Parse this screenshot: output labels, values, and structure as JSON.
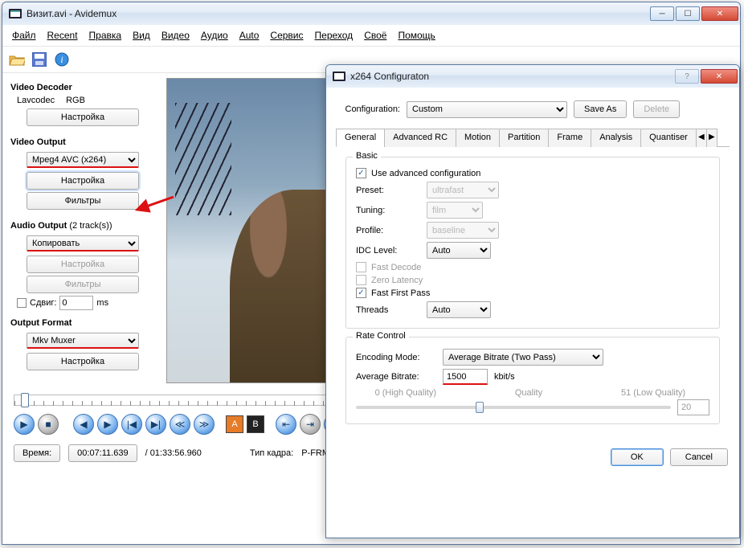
{
  "window": {
    "title": "Визит.avi - Avidemux"
  },
  "menu": [
    "Файл",
    "Recent",
    "Правка",
    "Вид",
    "Видео",
    "Аудио",
    "Auto",
    "Сервис",
    "Переход",
    "Своё",
    "Помощь"
  ],
  "sidebar": {
    "decoder_title": "Video Decoder",
    "decoder_items": [
      "Lavcodec",
      "RGB"
    ],
    "decoder_btn": "Настройка",
    "vout_title": "Video Output",
    "vout_codec": "Mpeg4 AVC (x264)",
    "vout_btn1": "Настройка",
    "vout_btn2": "Фильтры",
    "aout_title": "Audio Output",
    "aout_tracks": "(2 track(s))",
    "aout_mode": "Копировать",
    "aout_btn1": "Настройка",
    "aout_btn2": "Фильтры",
    "shift_label": "Сдвиг:",
    "shift_value": "0",
    "shift_unit": "ms",
    "ofmt_title": "Output Format",
    "ofmt_muxer": "Mkv Muxer",
    "ofmt_btn": "Настройка"
  },
  "status": {
    "time_label": "Время:",
    "time_value": "00:07:11.639",
    "total": "/ 01:33:56.960",
    "frame_label": "Тип кадра:",
    "frame_value": "P-FRM"
  },
  "dialog": {
    "title": "x264 Configuraton",
    "config_label": "Configuration:",
    "config_value": "Custom",
    "save_as": "Save As",
    "delete": "Delete",
    "tabs": [
      "General",
      "Advanced RC",
      "Motion",
      "Partition",
      "Frame",
      "Analysis",
      "Quantiser"
    ],
    "basic": {
      "legend": "Basic",
      "use_adv": "Use advanced configuration",
      "preset_label": "Preset:",
      "preset_value": "ultrafast",
      "tuning_label": "Tuning:",
      "tuning_value": "film",
      "profile_label": "Profile:",
      "profile_value": "baseline",
      "idc_label": "IDC Level:",
      "idc_value": "Auto",
      "fast_decode": "Fast Decode",
      "zero_latency": "Zero Latency",
      "fast_first": "Fast First Pass",
      "threads_label": "Threads",
      "threads_value": "Auto"
    },
    "rate": {
      "legend": "Rate Control",
      "mode_label": "Encoding Mode:",
      "mode_value": "Average Bitrate (Two Pass)",
      "avg_label": "Average Bitrate:",
      "avg_value": "1500",
      "avg_unit": "kbit/s",
      "q_low": "0 (High Quality)",
      "q_mid": "Quality",
      "q_high": "51 (Low Quality)",
      "q_spin": "20"
    },
    "ok": "OK",
    "cancel": "Cancel"
  }
}
